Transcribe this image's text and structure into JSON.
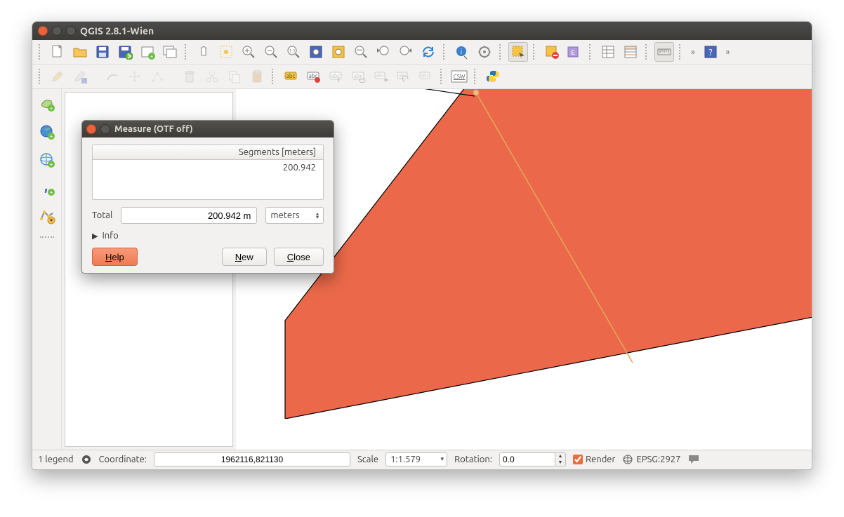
{
  "window_title": "QGIS 2.8.1-Wien",
  "measure_dialog": {
    "title": "Measure (OTF off)",
    "segments_header": "Segments [meters]",
    "segment_value": "200.942",
    "total_label": "Total",
    "total_value": "200.942 m",
    "units": "meters",
    "info_label": "Info",
    "help_btn": "Help",
    "new_btn": "New",
    "close_btn": "Close"
  },
  "status": {
    "legend_left": "1 legend",
    "coord_label": "Coordinate:",
    "coord_value": "1962116,821130",
    "scale_label": "Scale",
    "scale_value": "1:1.579",
    "rotation_label": "Rotation:",
    "rotation_value": "0.0",
    "render_label": "Render",
    "crs": "EPSG:2927"
  }
}
